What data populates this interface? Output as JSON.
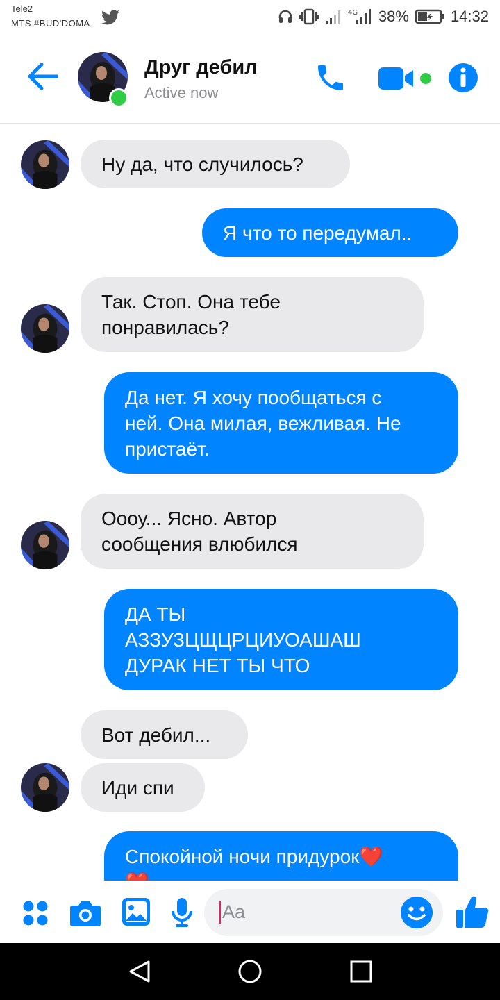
{
  "status_bar": {
    "carrier_1": "Tele2",
    "carrier_2": "MTS #BUD'DOMA",
    "battery": "38%",
    "time": "14:32"
  },
  "header": {
    "contact_name": "Друг дебил",
    "status": "Active now"
  },
  "messages": [
    {
      "from": "friend",
      "lines": [
        "Ну да, что случилось?"
      ]
    },
    {
      "from": "me",
      "lines": [
        "Я что то передумал.."
      ]
    },
    {
      "from": "friend",
      "lines": [
        "Так. Стоп. Она тебе",
        "понравилась?"
      ]
    },
    {
      "from": "me",
      "lines": [
        "Да нет. Я хочу пообщаться с",
        "ней. Она милая, вежливая. Не",
        "пристаёт."
      ]
    },
    {
      "from": "friend",
      "lines": [
        "Оооу... Ясно. Автор",
        "сообщения влюбился"
      ]
    },
    {
      "from": "me",
      "lines": [
        "ДА ТЫ",
        "АЗЗУЗЦЩЦРЦИУОАШАШ",
        "ДУРАК НЕТ ТЫ ЧТО"
      ]
    },
    {
      "from": "friend",
      "lines": [
        "Вот дебил..."
      ]
    },
    {
      "from": "friend",
      "lines": [
        "Иди спи"
      ]
    },
    {
      "from": "me",
      "lines": [
        "Спокойной ночи придурок❤️",
        "❤️"
      ]
    }
  ],
  "composer": {
    "placeholder": "Aa"
  },
  "colors": {
    "accent": "#0084ff",
    "incoming_bubble": "#e9e9eb",
    "online": "#31cc46"
  },
  "icons": [
    "back-arrow-icon",
    "phone-icon",
    "video-icon",
    "info-icon",
    "menu-dots-icon",
    "camera-icon",
    "gallery-icon",
    "mic-icon",
    "emoji-icon",
    "like-icon",
    "nav-back-icon",
    "nav-home-icon",
    "nav-recents-icon"
  ]
}
